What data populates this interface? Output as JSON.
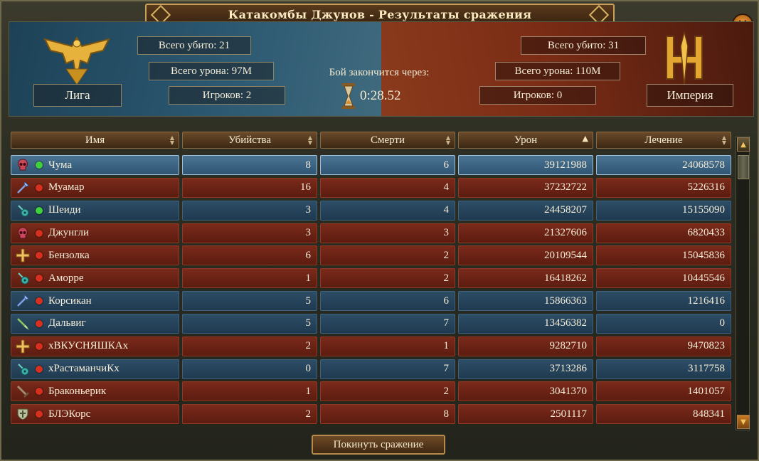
{
  "window": {
    "title": "Катакомбы Джунов - Результаты сражения",
    "close_label": "✕"
  },
  "league": {
    "name": "Лига",
    "total_kills": "Всего убито: 21",
    "total_damage": "Всего урона: 97M",
    "players": "Игроков: 2"
  },
  "empire": {
    "name": "Империя",
    "total_kills": "Всего убито: 31",
    "total_damage": "Всего урона: 110M",
    "players": "Игроков: 0"
  },
  "battle": {
    "ends_in_label": "Бой закончится через:",
    "timer": "0:28.52"
  },
  "table": {
    "headers": {
      "name": "Имя",
      "kills": "Убийства",
      "deaths": "Смерти",
      "damage": "Урон",
      "healing": "Лечение"
    },
    "sorted_by": "damage",
    "rows": [
      {
        "name": "Чума",
        "kills": "8",
        "deaths": "6",
        "damage": "39121988",
        "healing": "24068578",
        "faction": "league",
        "status": "online",
        "class_icon": "skull-icon",
        "selected": true
      },
      {
        "name": "Муамар",
        "kills": "16",
        "deaths": "4",
        "damage": "37232722",
        "healing": "5226316",
        "faction": "empire",
        "status": "offline",
        "class_icon": "staff-icon"
      },
      {
        "name": "Шеиди",
        "kills": "3",
        "deaths": "4",
        "damage": "24458207",
        "healing": "15155090",
        "faction": "league",
        "status": "online",
        "class_icon": "lute-icon"
      },
      {
        "name": "Джунгли",
        "kills": "3",
        "deaths": "3",
        "damage": "21327606",
        "healing": "6820433",
        "faction": "empire",
        "status": "offline",
        "class_icon": "skull-icon"
      },
      {
        "name": "Бензолка",
        "kills": "6",
        "deaths": "2",
        "damage": "20109544",
        "healing": "15045836",
        "faction": "empire",
        "status": "offline",
        "class_icon": "holy-cross-icon"
      },
      {
        "name": "Аморре",
        "kills": "1",
        "deaths": "2",
        "damage": "16418262",
        "healing": "10445546",
        "faction": "empire",
        "status": "offline",
        "class_icon": "lute-icon"
      },
      {
        "name": "Корсикан",
        "kills": "5",
        "deaths": "6",
        "damage": "15866363",
        "healing": "1216416",
        "faction": "league",
        "status": "offline",
        "class_icon": "staff-icon"
      },
      {
        "name": "Дальвиг",
        "kills": "5",
        "deaths": "7",
        "damage": "13456382",
        "healing": "0",
        "faction": "league",
        "status": "offline",
        "class_icon": "spear-icon"
      },
      {
        "name": "хВКУСНЯШКАх",
        "kills": "2",
        "deaths": "1",
        "damage": "9282710",
        "healing": "9470823",
        "faction": "empire",
        "status": "offline",
        "class_icon": "holy-cross-icon"
      },
      {
        "name": "хРастаманчиКх",
        "kills": "0",
        "deaths": "7",
        "damage": "3713286",
        "healing": "3117758",
        "faction": "league",
        "status": "offline",
        "class_icon": "lute-icon"
      },
      {
        "name": "Браконьерик",
        "kills": "1",
        "deaths": "2",
        "damage": "3041370",
        "healing": "1401057",
        "faction": "empire",
        "status": "offline",
        "class_icon": "sword-icon"
      },
      {
        "name": "БЛЭКорс",
        "kills": "2",
        "deaths": "8",
        "damage": "2501117",
        "healing": "848341",
        "faction": "empire",
        "status": "offline",
        "class_icon": "shield-icon"
      }
    ]
  },
  "footer": {
    "leave_label": "Покинуть сражение"
  },
  "colors": {
    "league_row": "#1f3a50",
    "empire_row": "#5c1c10",
    "online": "#3fd23a",
    "offline": "#d8301e",
    "accent_gold": "#d8b466"
  }
}
